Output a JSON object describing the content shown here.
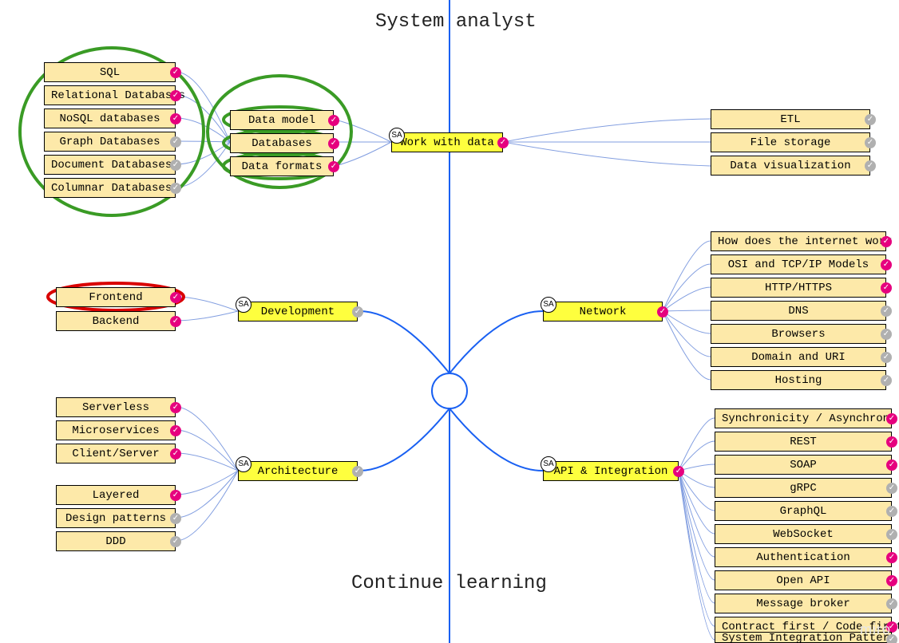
{
  "titles": {
    "top": "System analyst",
    "bottom": "Continue learning"
  },
  "sa_label": "SA",
  "main_nodes": {
    "work_with_data": "Work with data",
    "development": "Development",
    "architecture": "Architecture",
    "network": "Network",
    "api_integration": "API & Integration"
  },
  "data_mid": {
    "data_model": "Data model",
    "databases": "Databases",
    "data_formats": "Data formats"
  },
  "db_leaves": {
    "sql": "SQL",
    "relational": "Relational Databases",
    "nosql": "NoSQL databases",
    "graph": "Graph Databases",
    "document": "Document Databases",
    "columnar": "Columnar Databases"
  },
  "data_right": {
    "etl": "ETL",
    "file_storage": "File storage",
    "data_visualization": "Data visualization"
  },
  "dev_leaves": {
    "frontend": "Frontend",
    "backend": "Backend"
  },
  "arch_leaves": {
    "serverless": "Serverless",
    "microservices": "Microservices",
    "client_server": "Client/Server",
    "layered": "Layered",
    "design_patterns": "Design patterns",
    "ddd": "DDD"
  },
  "network_leaves": {
    "internet_work": "How does the internet work",
    "osi": "OSI and TCP/IP Models",
    "http": "HTTP/HTTPS",
    "dns": "DNS",
    "browsers": "Browsers",
    "domain_uri": "Domain and URI",
    "hosting": "Hosting"
  },
  "api_leaves": {
    "sync": "Synchronicity / Asynchrony",
    "rest": "REST",
    "soap": "SOAP",
    "grpc": "gRPC",
    "graphql": "GraphQL",
    "websocket": "WebSocket",
    "auth": "Authentication",
    "openapi": "Open API",
    "broker": "Message broker",
    "contract": "Contract first / Code first",
    "sip": "System Integration Patterns"
  },
  "watermark": "miro",
  "colors": {
    "pink": "#e6007e",
    "gray": "#b0b0b0",
    "green_anno": "#3a9b25",
    "red_anno": "#d90000",
    "line": "#1960f2"
  }
}
